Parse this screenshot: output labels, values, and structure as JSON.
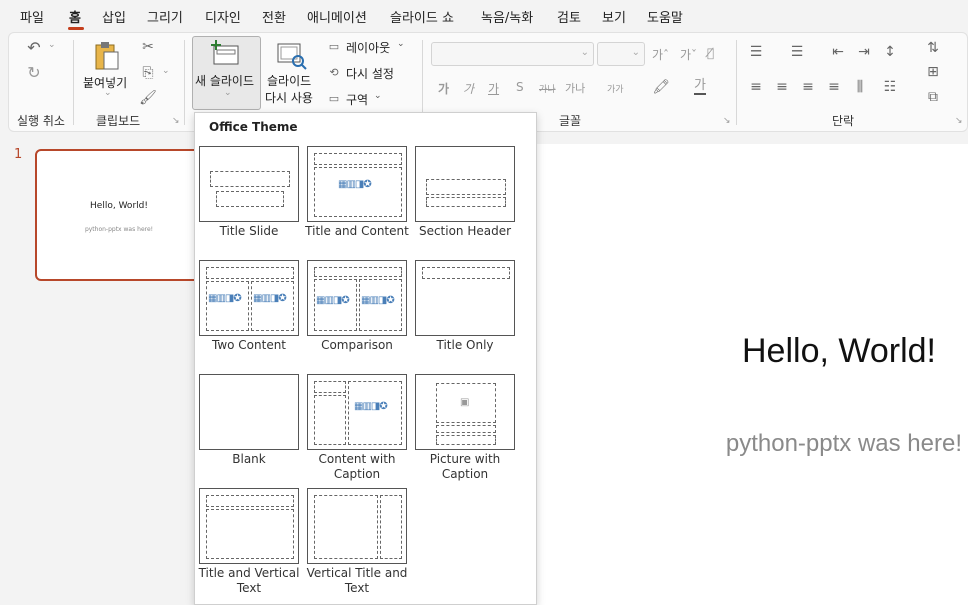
{
  "menu": {
    "items": [
      "파일",
      "홈",
      "삽입",
      "그리기",
      "디자인",
      "전환",
      "애니메이션",
      "슬라이드 쇼",
      "녹음/녹화",
      "검토",
      "보기",
      "도움말"
    ],
    "active": "홈"
  },
  "ribbon": {
    "undo_group_label": "실행 취소",
    "clipboard_group_label": "클립보드",
    "paste_label": "붙여넣기",
    "new_slide_label": "새 슬라이드",
    "reuse_slides_line1": "슬라이드",
    "reuse_slides_line2": "다시 사용",
    "layout_label": "레이아웃",
    "reset_label": "다시 설정",
    "section_label": "구역",
    "font_group_label": "글꼴",
    "paragraph_group_label": "단락",
    "font_buttons": [
      "가",
      "가",
      "가",
      "S",
      "가나",
      "가나",
      "가가"
    ],
    "highlight_glyph": "가"
  },
  "slides_pane": {
    "slide_number": "1",
    "thumb_title": "Hello, World!",
    "thumb_subtitle": "python-pptx was here!"
  },
  "slide": {
    "title": "Hello, World!",
    "subtitle": "python-pptx was here!"
  },
  "layout_gallery": {
    "theme": "Office Theme",
    "layouts": [
      {
        "name": "Title Slide"
      },
      {
        "name": "Title and Content"
      },
      {
        "name": "Section Header"
      },
      {
        "name": "Two Content"
      },
      {
        "name": "Comparison"
      },
      {
        "name": "Title Only"
      },
      {
        "name": "Blank"
      },
      {
        "name": "Content with\nCaption"
      },
      {
        "name": "Picture with\nCaption"
      },
      {
        "name": "Title and Vertical\nText"
      },
      {
        "name": "Vertical Title and\nText"
      }
    ]
  },
  "colors": {
    "accent": "#b7472a",
    "tab_underline": "#c43e1c"
  }
}
